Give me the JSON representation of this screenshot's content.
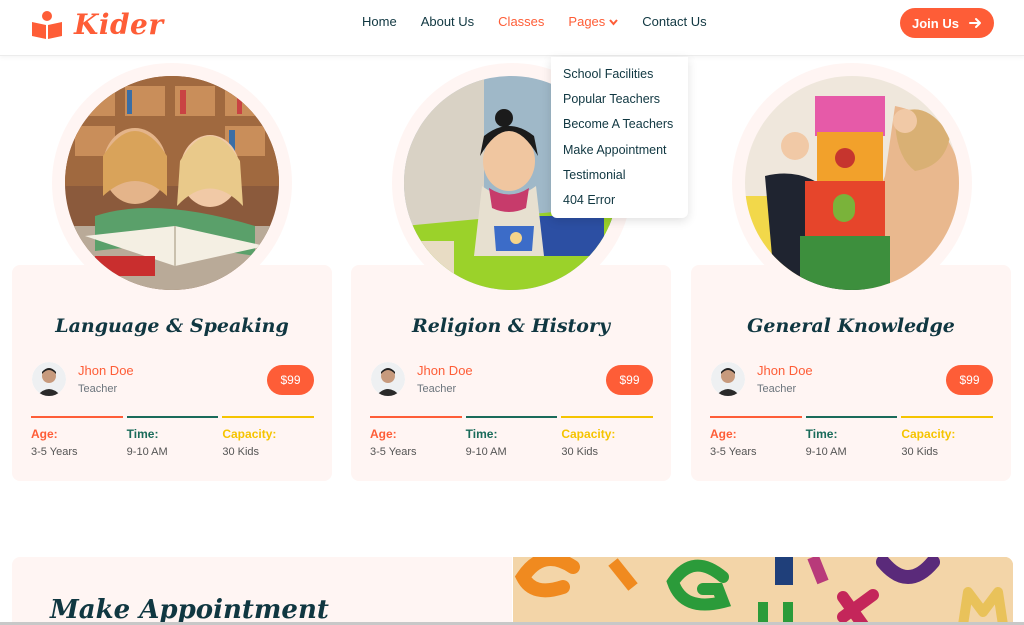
{
  "brand": {
    "name": "Kider"
  },
  "nav": {
    "items": [
      {
        "label": "Home"
      },
      {
        "label": "About Us"
      },
      {
        "label": "Classes"
      },
      {
        "label": "Pages"
      },
      {
        "label": "Contact Us"
      }
    ],
    "join_label": "Join Us"
  },
  "dropdown": {
    "items": [
      "School Facilities",
      "Popular Teachers",
      "Become A Teachers",
      "Make Appointment",
      "Testimonial",
      "404 Error"
    ]
  },
  "classes": [
    {
      "title": "Language & Speaking",
      "teacher": "Jhon Doe",
      "role": "Teacher",
      "price": "$99",
      "stats": [
        {
          "label": "Age:",
          "value": "3-5 Years"
        },
        {
          "label": "Time:",
          "value": "9-10 AM"
        },
        {
          "label": "Capacity:",
          "value": "30 Kids"
        }
      ]
    },
    {
      "title": "Religion & History",
      "teacher": "Jhon Doe",
      "role": "Teacher",
      "price": "$99",
      "stats": [
        {
          "label": "Age:",
          "value": "3-5 Years"
        },
        {
          "label": "Time:",
          "value": "9-10 AM"
        },
        {
          "label": "Capacity:",
          "value": "30 Kids"
        }
      ]
    },
    {
      "title": "General Knowledge",
      "teacher": "Jhon Doe",
      "role": "Teacher",
      "price": "$99",
      "stats": [
        {
          "label": "Age:",
          "value": "3-5 Years"
        },
        {
          "label": "Time:",
          "value": "9-10 AM"
        },
        {
          "label": "Capacity:",
          "value": "30 Kids"
        }
      ]
    }
  ],
  "appointment": {
    "title": "Make Appointment"
  },
  "colors": {
    "primary": "#FE5D37",
    "dark": "#103741",
    "teal": "#1A6B5A",
    "yellow": "#F5C400",
    "light": "#FFF5F3"
  }
}
